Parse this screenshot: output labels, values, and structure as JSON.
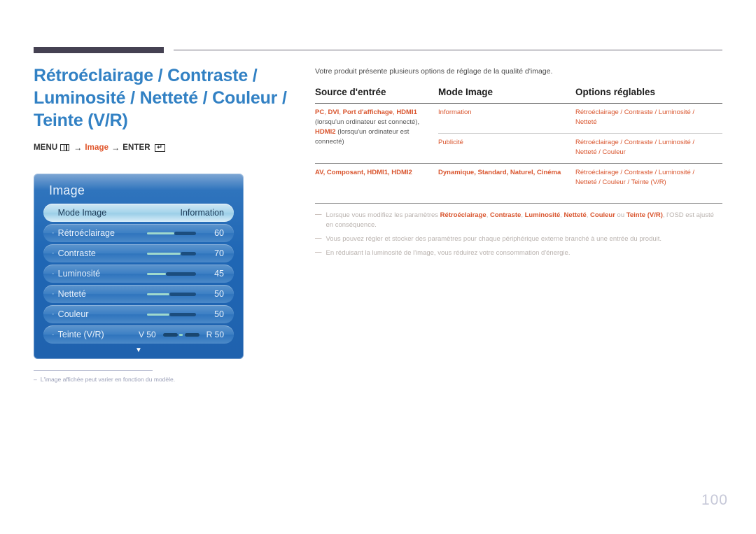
{
  "page": {
    "number": "100"
  },
  "title": "Rétroéclairage / Contraste /\nLuminosité / Netteté / Couleur /\nTeinte (V/R)",
  "menu_path": {
    "menu_label": "MENU",
    "menu_icon": "menu-grid-icon",
    "arrow1": "→",
    "middle_label": "Image",
    "arrow2": "→",
    "enter_label": "ENTER",
    "enter_icon": "↵"
  },
  "osd": {
    "title": "Image",
    "rows": [
      {
        "label": "Mode Image",
        "value": "Information",
        "type": "selected"
      },
      {
        "label": "Rétroéclairage",
        "value": "60",
        "type": "slider",
        "fill_pct": 55
      },
      {
        "label": "Contraste",
        "value": "70",
        "type": "slider",
        "fill_pct": 68
      },
      {
        "label": "Luminosité",
        "value": "45",
        "type": "slider",
        "fill_pct": 38
      },
      {
        "label": "Netteté",
        "value": "50",
        "type": "slider",
        "fill_pct": 45
      },
      {
        "label": "Couleur",
        "value": "50",
        "type": "slider",
        "fill_pct": 45
      },
      {
        "label": "Teinte (V/R)",
        "value_left": "V 50",
        "value_right": "R 50",
        "type": "dual"
      }
    ],
    "scroll_icon": "chevron-down-icon"
  },
  "left_note": {
    "dash": "–",
    "text": "L'image affichée peut varier en fonction du modèle."
  },
  "right": {
    "intro": "Votre produit présente plusieurs options de réglage de la qualité d'image.",
    "table": {
      "headers": [
        "Source d'entrée",
        "Mode Image",
        "Options réglables"
      ],
      "source_1_parts": [
        {
          "t": "PC",
          "b": true
        },
        {
          "t": ", ",
          "b": false
        },
        {
          "t": "DVI",
          "b": true
        },
        {
          "t": ", ",
          "b": false
        },
        {
          "t": "Port d'affichage",
          "b": true
        },
        {
          "t": ", ",
          "b": false
        },
        {
          "t": "HDMI1",
          "b": true
        },
        {
          "t": " (lorsqu'un ordinateur est connecté), ",
          "b": false,
          "plain": true
        },
        {
          "t": "HDMI2",
          "b": true
        },
        {
          "t": " (lorsqu'un ordinateur est connecté)",
          "b": false,
          "plain": true
        }
      ],
      "source_2": "AV, Composant, HDMI1, HDMI2",
      "modes": {
        "row1": "Information",
        "row2": "Publicité",
        "row3": "Dynamique, Standard, Naturel, Cinéma"
      },
      "options": {
        "row1": "Rétroéclairage / Contraste / Luminosité / Netteté",
        "row2": "Rétroéclairage / Contraste / Luminosité / Netteté / Couleur",
        "row3": "Rétroéclairage / Contraste / Luminosité / Netteté / Couleur / Teinte (V/R)"
      }
    },
    "notes": [
      {
        "dash": "―",
        "segments": [
          {
            "t": "Lorsque vous modifiez les paramètres ",
            "hl": false
          },
          {
            "t": "Rétroéclairage",
            "hl": true
          },
          {
            "t": ", ",
            "hl": false
          },
          {
            "t": "Contraste",
            "hl": true
          },
          {
            "t": ", ",
            "hl": false
          },
          {
            "t": "Luminosité",
            "hl": true
          },
          {
            "t": ", ",
            "hl": false
          },
          {
            "t": "Netteté",
            "hl": true
          },
          {
            "t": ", ",
            "hl": false
          },
          {
            "t": "Couleur",
            "hl": true
          },
          {
            "t": " ou ",
            "hl": false
          },
          {
            "t": "Teinte (V/R)",
            "hl": true
          },
          {
            "t": ", l'OSD est ajusté en conséquence.",
            "hl": false
          }
        ]
      },
      {
        "dash": "―",
        "segments": [
          {
            "t": "Vous pouvez régler et stocker des paramètres pour chaque périphérique externe branché à une entrée du produit.",
            "hl": false
          }
        ]
      },
      {
        "dash": "―",
        "segments": [
          {
            "t": "En réduisant la luminosité de l'image, vous réduirez votre consommation d'énergie.",
            "hl": false
          }
        ]
      }
    ]
  },
  "colors": {
    "title_blue": "#3281c4",
    "accent_orange": "#d9552e",
    "osd_blue": "#1f66b4",
    "rule_dark": "#454152"
  }
}
